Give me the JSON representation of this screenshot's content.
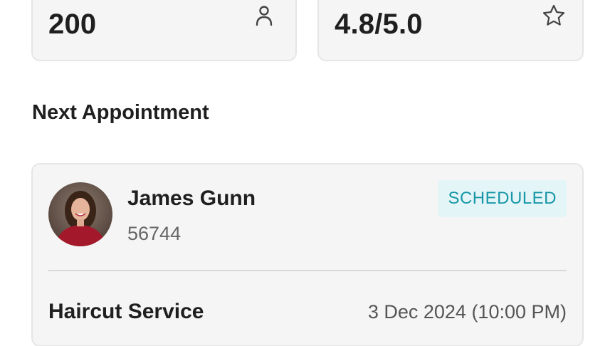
{
  "stats": {
    "clients": {
      "value": "200",
      "icon": "person-icon"
    },
    "rating": {
      "value": "4.8/5.0",
      "icon": "star-icon"
    }
  },
  "next_appointment": {
    "section_title": "Next Appointment",
    "client_name": "James Gunn",
    "client_id": "56744",
    "status": "SCHEDULED",
    "service": "Haircut Service",
    "datetime": "3 Dec 2024 (10:00 PM)"
  },
  "colors": {
    "card_bg": "#f5f5f5",
    "card_border": "#e6e6e6",
    "badge_bg": "#e4f5f8",
    "badge_text": "#1797a6"
  }
}
